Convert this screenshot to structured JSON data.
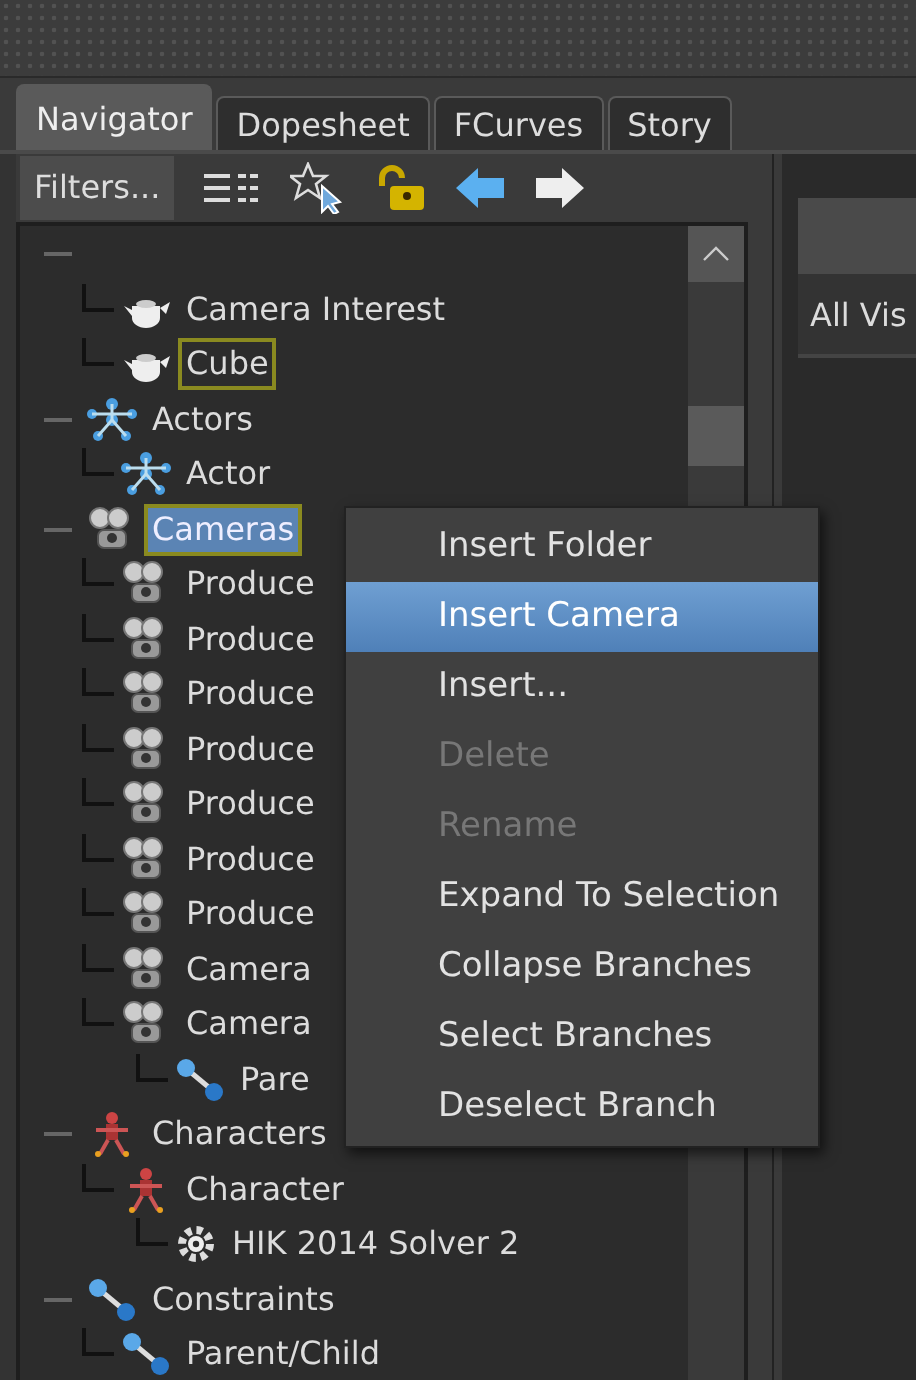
{
  "tabs": [
    {
      "label": "Navigator",
      "selected": true
    },
    {
      "label": "Dopesheet",
      "selected": false
    },
    {
      "label": "FCurves",
      "selected": false
    },
    {
      "label": "Story",
      "selected": false
    }
  ],
  "toolbar": {
    "filters_button": "Filters..."
  },
  "tree": [
    {
      "children": [
        {
          "label": "Camera Interest",
          "kind": "teapot",
          "selected": false,
          "focused": false
        },
        {
          "label": "Cube",
          "kind": "teapot",
          "selected": false,
          "focused": true
        }
      ]
    },
    {
      "label": "Actors",
      "kind": "actor",
      "selected": false,
      "focused": false,
      "children": [
        {
          "label": "Actor",
          "kind": "actor",
          "selected": false,
          "focused": false
        }
      ]
    },
    {
      "label": "Cameras",
      "kind": "camera",
      "selected": true,
      "focused": true,
      "children": [
        {
          "label": "Produce",
          "kind": "camera",
          "selected": false,
          "focused": false
        },
        {
          "label": "Produce",
          "kind": "camera",
          "selected": false,
          "focused": false
        },
        {
          "label": "Produce",
          "kind": "camera",
          "selected": false,
          "focused": false
        },
        {
          "label": "Produce",
          "kind": "camera",
          "selected": false,
          "focused": false
        },
        {
          "label": "Produce",
          "kind": "camera",
          "selected": false,
          "focused": false
        },
        {
          "label": "Produce",
          "kind": "camera",
          "selected": false,
          "focused": false
        },
        {
          "label": "Produce",
          "kind": "camera",
          "selected": false,
          "focused": false
        },
        {
          "label": "Camera",
          "kind": "camera",
          "selected": false,
          "focused": false
        },
        {
          "label": "Camera",
          "kind": "camera",
          "selected": false,
          "focused": false,
          "children": [
            {
              "label": "Pare",
              "kind": "constraint",
              "selected": false,
              "focused": false
            }
          ]
        }
      ]
    },
    {
      "label": "Characters",
      "kind": "character",
      "selected": false,
      "focused": false,
      "children": [
        {
          "label": "Character",
          "kind": "character",
          "selected": false,
          "focused": false,
          "children": [
            {
              "label": "HIK 2014 Solver 2",
              "kind": "solver",
              "selected": false,
              "focused": false
            }
          ]
        }
      ]
    },
    {
      "label": "Constraints",
      "kind": "constraint",
      "selected": false,
      "focused": false,
      "children": [
        {
          "label": "Parent/Child",
          "kind": "constraint",
          "selected": false,
          "focused": false
        }
      ]
    }
  ],
  "context_menu": [
    {
      "label": "Insert Folder",
      "disabled": false,
      "selected": false
    },
    {
      "label": "Insert Camera",
      "disabled": false,
      "selected": true
    },
    {
      "label": "Insert...",
      "disabled": false,
      "selected": false
    },
    {
      "label": "Delete",
      "disabled": true,
      "selected": false
    },
    {
      "label": "Rename",
      "disabled": true,
      "selected": false
    },
    {
      "label": "Expand To Selection",
      "disabled": false,
      "selected": false
    },
    {
      "label": "Collapse Branches",
      "disabled": false,
      "selected": false
    },
    {
      "label": "Select Branches",
      "disabled": false,
      "selected": false
    },
    {
      "label": "Deselect Branch",
      "disabled": false,
      "selected": false
    }
  ],
  "right_panel": {
    "header_text": "All Vis"
  }
}
